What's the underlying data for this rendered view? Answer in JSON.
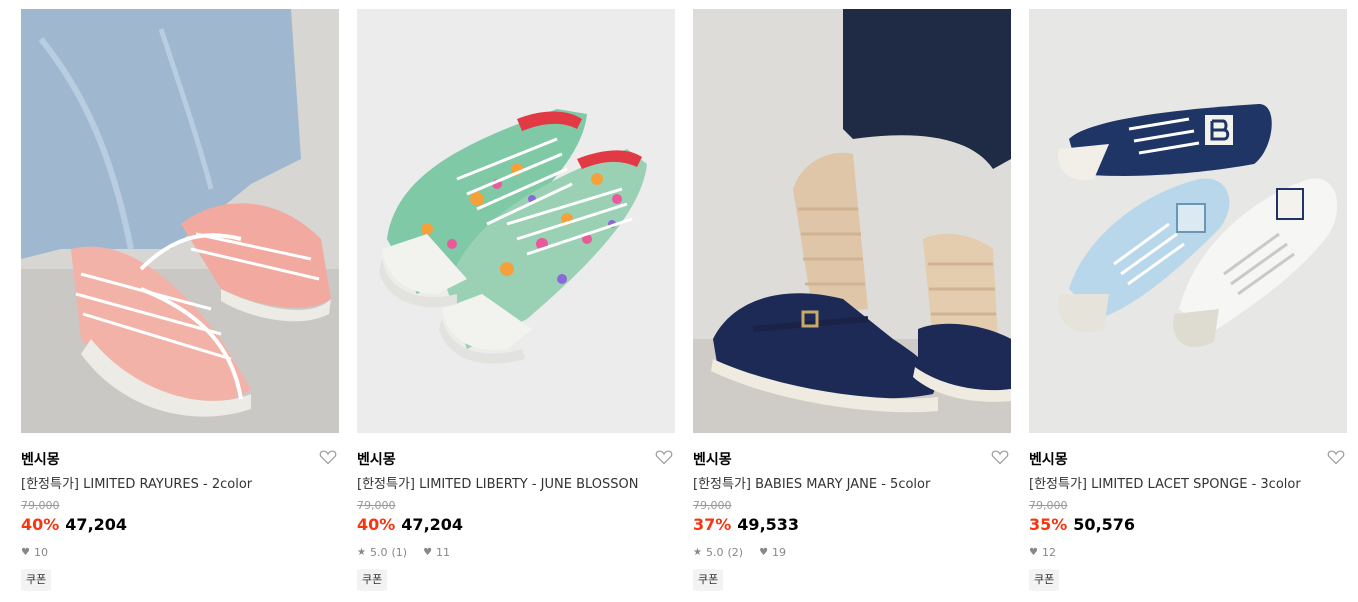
{
  "products": [
    {
      "brand": "벤시몽",
      "title": "[한정특가] LIMITED RAYURES - 2color",
      "original_price": "79,000",
      "discount": "40%",
      "price": "47,204",
      "rating": "",
      "review_count": "",
      "likes": "10",
      "coupon_label": "쿠폰",
      "image_icon": "striped-sneaker-photo"
    },
    {
      "brand": "벤시몽",
      "title": "[한정특가] LIMITED LIBERTY - JUNE BLOSSON",
      "original_price": "79,000",
      "discount": "40%",
      "price": "47,204",
      "rating": "5.0",
      "review_count": "(1)",
      "likes": "11",
      "coupon_label": "쿠폰",
      "image_icon": "floral-sneaker-photo"
    },
    {
      "brand": "벤시몽",
      "title": "[한정특가] BABIES MARY JANE - 5color",
      "original_price": "79,000",
      "discount": "37%",
      "price": "49,533",
      "rating": "5.0",
      "review_count": "(2)",
      "likes": "19",
      "coupon_label": "쿠폰",
      "image_icon": "mary-jane-shoe-photo"
    },
    {
      "brand": "벤시몽",
      "title": "[한정특가] LIMITED LACET SPONGE - 3color",
      "original_price": "79,000",
      "discount": "35%",
      "price": "50,576",
      "rating": "",
      "review_count": "",
      "likes": "12",
      "coupon_label": "쿠폰",
      "image_icon": "lacet-sponge-sneaker-photo"
    }
  ],
  "colors": {
    "discount": "#f7350e",
    "strike": "#999999",
    "coupon_bg": "#f3f3f3"
  }
}
